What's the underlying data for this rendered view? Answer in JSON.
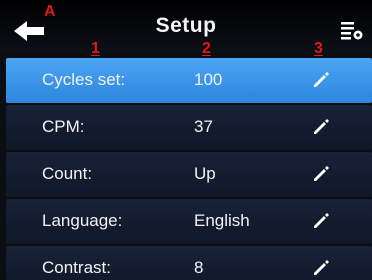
{
  "header": {
    "title": "Setup",
    "back_marker": "A",
    "back_icon": "back-arrow-icon",
    "menu_icon": "settings-list-icon"
  },
  "column_markers": [
    "1",
    "2",
    "3"
  ],
  "settings": [
    {
      "label": "Cycles set:",
      "value": "100",
      "selected": true
    },
    {
      "label": "CPM:",
      "value": "37",
      "selected": false
    },
    {
      "label": "Count:",
      "value": "Up",
      "selected": false
    },
    {
      "label": "Language:",
      "value": "English",
      "selected": false
    },
    {
      "label": "Contrast:",
      "value": "8",
      "selected": false
    }
  ],
  "colors": {
    "accent_selected": "#3a94e8",
    "row_background": "#141d30",
    "marker_red": "#e01818"
  }
}
